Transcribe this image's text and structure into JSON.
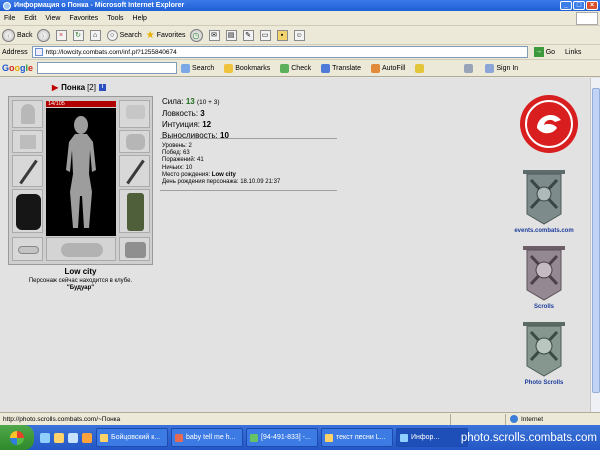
{
  "window": {
    "title": "Информация о Понка - Microsoft Internet Explorer"
  },
  "menu": [
    "File",
    "Edit",
    "View",
    "Favorites",
    "Tools",
    "Help"
  ],
  "toolbar": {
    "back_label": "Back",
    "search_label": "Search",
    "favorites_label": "Favorites"
  },
  "address": {
    "label": "Address",
    "url": "http://lowcity.combats.com/inf.pl?1255840674",
    "go_label": "Go",
    "links_label": "Links"
  },
  "google_toolbar": {
    "logo": [
      "G",
      "o",
      "o",
      "g",
      "l",
      "e"
    ],
    "search_label": "Search",
    "bookmarks_label": "Bookmarks",
    "check_label": "Check",
    "translate_label": "Translate",
    "autofill_label": "AutoFill",
    "signin_label": "Sign In"
  },
  "character": {
    "name": "Понка",
    "level_bracket": "[2]",
    "hp": "14/105",
    "city": "Low city",
    "club_text": "Персонаж сейчас находится в клубе.",
    "club_name": "\"Будуар\""
  },
  "stats": [
    {
      "label": "Сила:",
      "value": "13",
      "extra": "(10 + 3)",
      "value_color": "#1f6e1f"
    },
    {
      "label": "Ловкость:",
      "value": "3",
      "extra": "",
      "value_color": "#000000"
    },
    {
      "label": "Интуиция:",
      "value": "12",
      "extra": "",
      "value_color": "#000000"
    },
    {
      "label": "Выносливость:",
      "value": "10",
      "extra": "",
      "value_color": "#000000"
    }
  ],
  "info": {
    "level": "Уровень: 2",
    "wins": "Побед: 63",
    "losses": "Поражений: 41",
    "draws": "Ничьих: 10",
    "birthplace_label": "Место рождения: ",
    "birthplace_value": "Low city",
    "birthday": "День рождения персонажа: 18.10.09 21:37"
  },
  "right_links": {
    "events": "events.combats.com",
    "scrolls": "Scrolls",
    "photo": "Photo Scrolls"
  },
  "status": {
    "url": "http://photo.scrolls.combats.com/~Понка",
    "zone": "Internet"
  },
  "taskbar": {
    "tasks": [
      "Бойцовский к...",
      "baby tell me h...",
      "[94-491-833] -...",
      "текст песни L...",
      "Инфор..."
    ],
    "watermark": "photo.scrolls.combats.com"
  },
  "colors": {
    "hp_bar": "#b00000",
    "link": "#1d3c9a",
    "strength_value": "#1f6e1f",
    "logo_red": "#d81e1e"
  },
  "icons": {
    "window": "ie-icon",
    "go": "go-arrow-icon",
    "zone": "globe-icon",
    "start": "windows-flag-icon"
  }
}
